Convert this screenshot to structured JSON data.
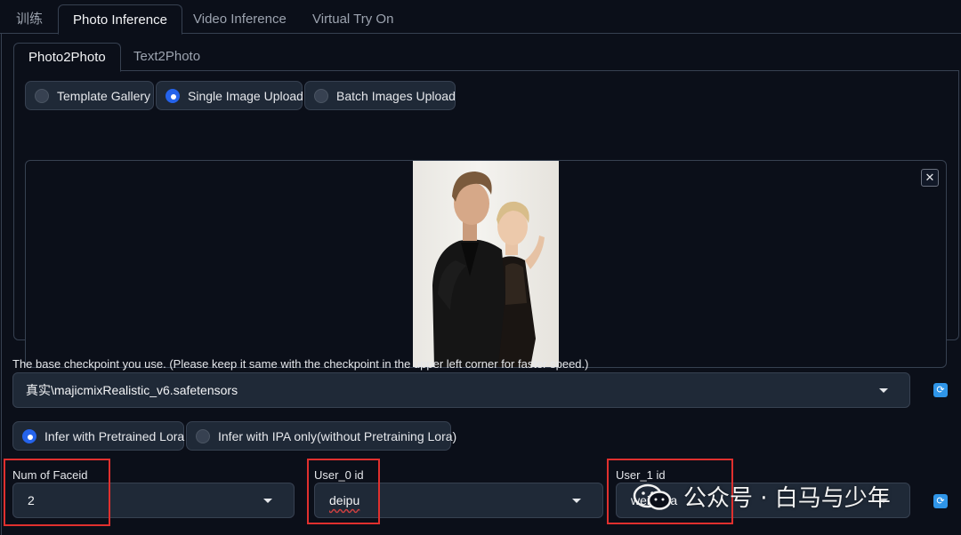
{
  "top_tabs": [
    {
      "label": "训练"
    },
    {
      "label": "Photo Inference"
    },
    {
      "label": "Video Inference"
    },
    {
      "label": "Virtual Try On"
    }
  ],
  "inner_tabs": [
    {
      "label": "Photo2Photo"
    },
    {
      "label": "Text2Photo"
    }
  ],
  "upload_modes": [
    {
      "label": "Template Gallery",
      "selected": false
    },
    {
      "label": "Single Image Upload",
      "selected": true
    },
    {
      "label": "Batch Images Upload",
      "selected": false
    }
  ],
  "upload": {
    "close_label": "✕"
  },
  "checkpoint": {
    "label": "The base checkpoint you use. (Please keep it same with the checkpoint in the upper left corner for faster speed.)",
    "value": "真实\\majicmixRealistic_v6.safetensors",
    "refresh_icon": "refresh-icon"
  },
  "lora_modes": [
    {
      "label": "Infer with Pretrained Lora",
      "selected": true
    },
    {
      "label": "Infer with IPA only(without Pretraining Lora)",
      "selected": false
    }
  ],
  "fields": {
    "num_faceid": {
      "label": "Num of Faceid",
      "value": "2"
    },
    "user0": {
      "label": "User_0 id",
      "value": "deipu"
    },
    "user1": {
      "label": "User_1 id",
      "value": "weiruoia"
    }
  },
  "watermark": {
    "text": "公众号 · 白马与少年"
  },
  "colors": {
    "accent": "#2563eb",
    "background": "#0b0f19",
    "highlight": "#e0302e",
    "refresh": "#2f95e8"
  }
}
